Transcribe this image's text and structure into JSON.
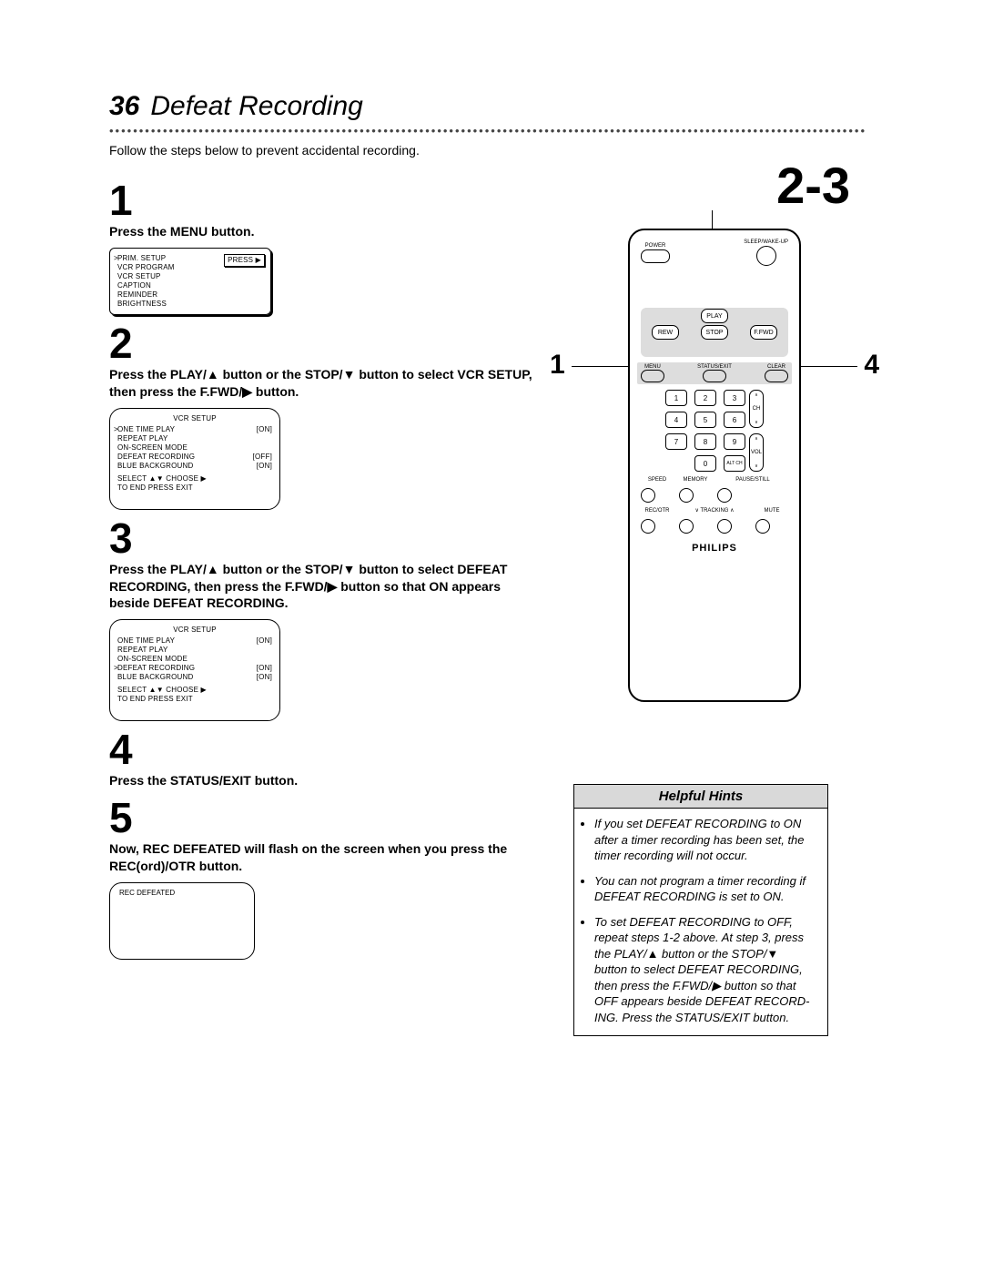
{
  "page": {
    "number": "36",
    "title": "Defeat Recording",
    "intro": "Follow the steps below to prevent accidental recording."
  },
  "steps": {
    "s1": {
      "n": "1",
      "text": "Press the MENU button."
    },
    "s2": {
      "n": "2",
      "text": "Press the PLAY/▲ button or the STOP/▼ button to select VCR SETUP, then press the F.FWD/▶ button."
    },
    "s3": {
      "n": "3",
      "text": "Press the PLAY/▲ button or the STOP/▼ button to select DEFEAT RECORDING, then press the F.FWD/▶ button so that ON appears beside DEFEAT RECORDING."
    },
    "s4": {
      "n": "4",
      "text": "Press the STATUS/EXIT button."
    },
    "s5": {
      "n": "5",
      "text": "Now, REC DEFEATED will flash on the screen when you press the REC(ord)/OTR button."
    }
  },
  "tv1": {
    "press": "PRESS ▶",
    "items": [
      "PRIM. SETUP",
      "VCR PROGRAM",
      "VCR SETUP",
      "CAPTION",
      "REMINDER",
      "BRIGHTNESS"
    ]
  },
  "tv2": {
    "title": "VCR SETUP",
    "rows": [
      {
        "l": "ONE TIME PLAY",
        "r": "[ON]",
        "sel": true
      },
      {
        "l": "REPEAT PLAY",
        "r": ""
      },
      {
        "l": "ON-SCREEN MODE",
        "r": ""
      },
      {
        "l": "DEFEAT RECORDING",
        "r": "[OFF]"
      },
      {
        "l": "BLUE BACKGROUND",
        "r": "[ON]"
      }
    ],
    "footer1": "SELECT ▲▼ CHOOSE ▶",
    "footer2": "TO END PRESS EXIT"
  },
  "tv3": {
    "title": "VCR SETUP",
    "rows": [
      {
        "l": "ONE TIME PLAY",
        "r": "[ON]"
      },
      {
        "l": "REPEAT PLAY",
        "r": ""
      },
      {
        "l": "ON-SCREEN MODE",
        "r": ""
      },
      {
        "l": "DEFEAT RECORDING",
        "r": "[ON]",
        "sel": true
      },
      {
        "l": "BLUE BACKGROUND",
        "r": "[ON]"
      }
    ],
    "footer1": "SELECT ▲▼ CHOOSE ▶",
    "footer2": "TO END PRESS EXIT"
  },
  "tv4": {
    "line": "REC DEFEATED"
  },
  "remote": {
    "big": "2-3",
    "callout_left": "1",
    "callout_right": "4",
    "power": "POWER",
    "sleep": "SLEEP/WAKE-UP",
    "play": "PLAY",
    "rew": "REW",
    "stop": "STOP",
    "ffwd": "F.FWD",
    "menu": "MENU",
    "status": "STATUS/EXIT",
    "clear": "CLEAR",
    "digits": [
      "1",
      "2",
      "3",
      "4",
      "5",
      "6",
      "7",
      "8",
      "9",
      "0"
    ],
    "altch": "ALT CH",
    "ch": "CH",
    "vol": "VOL",
    "speed": "SPEED",
    "memory": "MEMORY",
    "pause": "PAUSE/STILL",
    "rec": "REC/OTR",
    "tracking": "TRACKING",
    "mute": "MUTE",
    "brand": "PHILIPS"
  },
  "hints": {
    "title": "Helpful Hints",
    "items": [
      "If you set DEFEAT RECORDING to ON after a timer recording has been set, the timer recording will not occur.",
      "You can not program a timer recording if DEFEAT RECORDING is set to ON.",
      "To set DEFEAT RECORDING to OFF, repeat steps 1-2 above. At step 3, press the PLAY/▲ button or the STOP/▼ button to select DEFEAT RECORDING, then press the F.FWD/▶ button so that OFF appears beside DEFEAT RECORD-ING. Press the STATUS/EXIT button."
    ]
  }
}
